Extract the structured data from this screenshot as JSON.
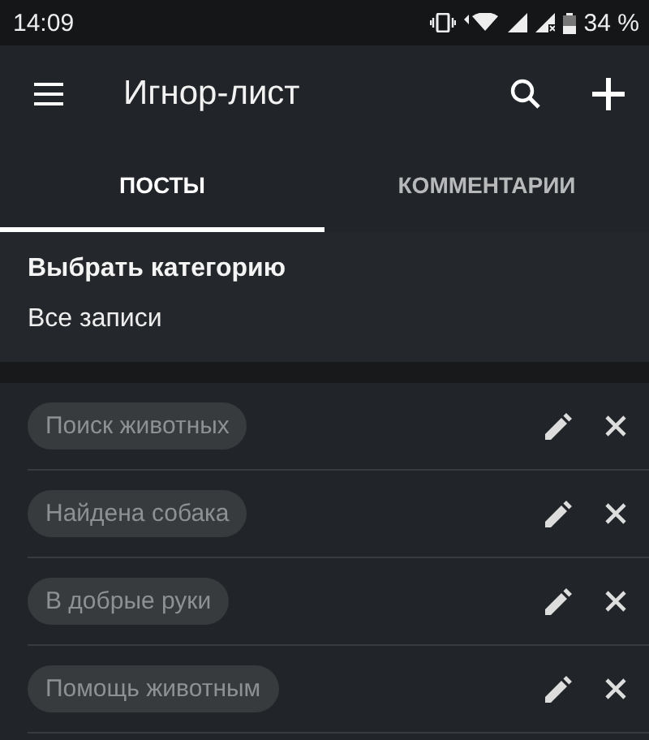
{
  "status_bar": {
    "time": "14:09",
    "battery": "34 %"
  },
  "app_bar": {
    "title": "Игнор-лист"
  },
  "tabs": [
    {
      "label": "ПОСТЫ",
      "selected": true
    },
    {
      "label": "КОММЕНТАРИИ",
      "selected": false
    }
  ],
  "category": {
    "heading": "Выбрать категорию",
    "value": "Все записи"
  },
  "items": [
    {
      "label": "Поиск животных"
    },
    {
      "label": "Найдена собака"
    },
    {
      "label": "В добрые руки"
    },
    {
      "label": "Помощь животным"
    }
  ]
}
